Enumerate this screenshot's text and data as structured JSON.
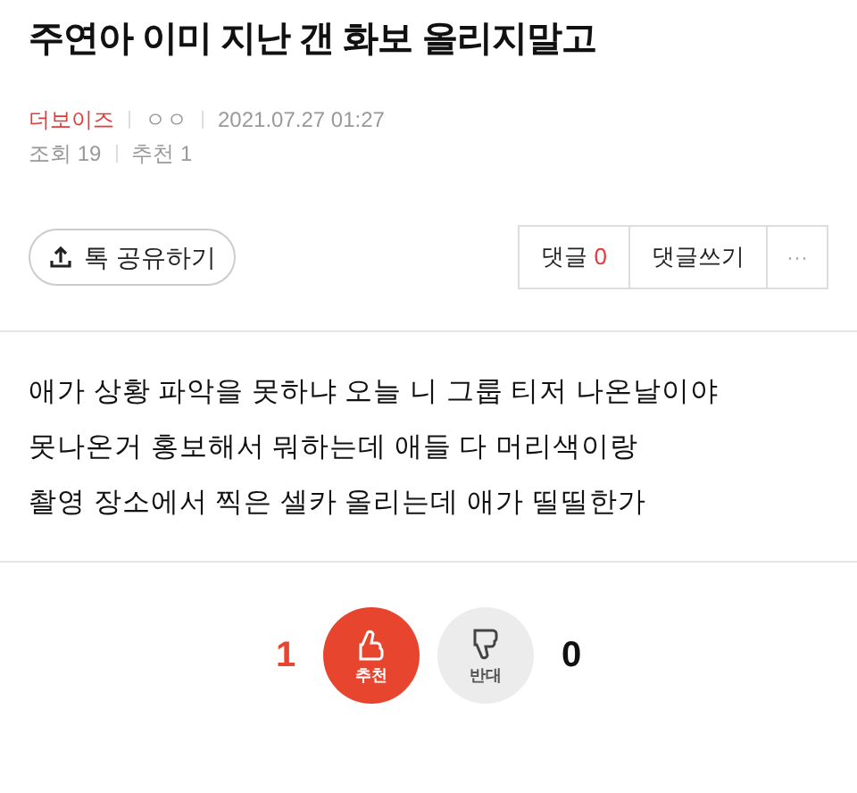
{
  "title": "주연아 이미 지난 갠 화보 올리지말고",
  "meta": {
    "board": "더보이즈",
    "author": "ㅇㅇ",
    "date": "2021.07.27 01:27",
    "views_label": "조회",
    "views": "19",
    "recommend_label": "추천",
    "recommend": "1"
  },
  "share_button": "톡 공유하기",
  "comment_buttons": {
    "comments_label": "댓글",
    "comments_count": "0",
    "write": "댓글쓰기",
    "more": "···"
  },
  "body": [
    "애가 상황 파악을 못하냐 오늘 니 그룹 티저 나온날이야",
    "못나온거 홍보해서 뭐하는데 애들 다 머리색이랑",
    "촬영 장소에서 찍은 셀카 올리는데 애가 띨띨한가"
  ],
  "votes": [
    {
      "kind": "up",
      "label": "추천",
      "count": "1",
      "selected": true
    },
    {
      "kind": "down",
      "label": "반대",
      "count": "0",
      "selected": false
    }
  ]
}
